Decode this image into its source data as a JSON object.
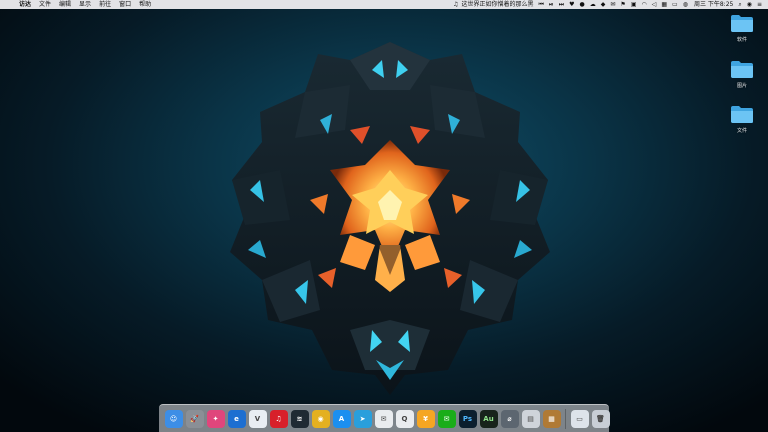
{
  "menubar": {
    "app_menu": "访达",
    "menus": [
      "文件",
      "编辑",
      "显示",
      "前往",
      "窗口",
      "帮助"
    ],
    "now_playing": "这世界正如你憎着的那么黑",
    "clock": "周三 下午8:25"
  },
  "desktop": {
    "folders": [
      {
        "label": "软件"
      },
      {
        "label": "图片"
      },
      {
        "label": "文件"
      }
    ],
    "folder_color": "#5ab8ee"
  },
  "dock": {
    "apps": [
      {
        "icon": "finder-icon",
        "glyph": "☺",
        "color": "#3d8ee6"
      },
      {
        "icon": "launchpad-icon",
        "glyph": "🚀",
        "color": "#8a8f96"
      },
      {
        "icon": "cleanmymac-icon",
        "glyph": "✦",
        "color": "#e0467c"
      },
      {
        "icon": "browser-e-icon",
        "glyph": "e",
        "color": "#1d6fd1"
      },
      {
        "icon": "vpn-v-icon",
        "glyph": "V",
        "color": "#e9eef3"
      },
      {
        "icon": "netease-music-icon",
        "glyph": "♫",
        "color": "#d8202a"
      },
      {
        "icon": "audio-wave-icon",
        "glyph": "≋",
        "color": "#1f2a33"
      },
      {
        "icon": "chrome-icon",
        "glyph": "◉",
        "color": "#e4b020"
      },
      {
        "icon": "app-store-icon",
        "glyph": "A",
        "color": "#1b8ff0"
      },
      {
        "icon": "telegram-icon",
        "glyph": "➤",
        "color": "#2a9fdc"
      },
      {
        "icon": "wechat-icon",
        "glyph": "✉",
        "color": "#e9ecef"
      },
      {
        "icon": "qq-icon",
        "glyph": "Q",
        "color": "#e9ecef"
      },
      {
        "icon": "coin-icon",
        "glyph": "¥",
        "color": "#f5a623"
      },
      {
        "icon": "wechat-green-icon",
        "glyph": "✉",
        "color": "#1aad19"
      },
      {
        "icon": "photoshop-icon",
        "glyph": "Ps",
        "color": "#0b1f2e"
      },
      {
        "icon": "audition-icon",
        "glyph": "Au",
        "color": "#17231b"
      },
      {
        "icon": "disk-utility-icon",
        "glyph": "⌀",
        "color": "#5c6670"
      },
      {
        "icon": "printer-icon",
        "glyph": "▤",
        "color": "#cfd4da"
      },
      {
        "icon": "archive-box-icon",
        "glyph": "▦",
        "color": "#b07a35"
      }
    ],
    "after_separator": [
      {
        "icon": "downloads-folder-icon",
        "glyph": "▭",
        "color": "#dde3ea"
      },
      {
        "icon": "trash-icon",
        "glyph": "🗑",
        "color": "#c8ced6"
      }
    ]
  }
}
